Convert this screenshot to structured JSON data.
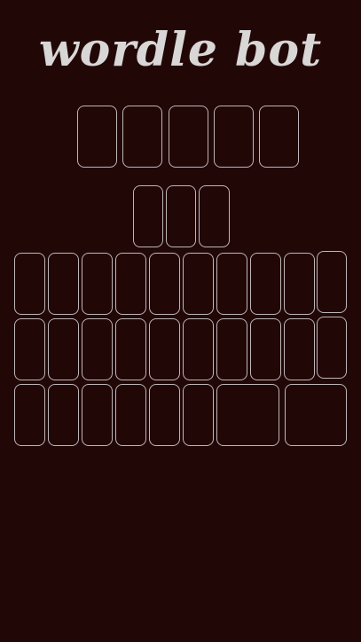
{
  "header": {
    "title": "wordle bot"
  },
  "guess_row": {
    "tiles": [
      "",
      "",
      "",
      "",
      ""
    ]
  },
  "score_row": {
    "tiles": [
      "",
      "",
      ""
    ]
  },
  "keyboard": {
    "row1": [
      "",
      "",
      "",
      "",
      "",
      "",
      "",
      "",
      "",
      ""
    ],
    "row2": [
      "",
      "",
      "",
      "",
      "",
      "",
      "",
      "",
      "",
      ""
    ],
    "row3": [
      "",
      "",
      "",
      "",
      "",
      "",
      "",
      ""
    ]
  }
}
